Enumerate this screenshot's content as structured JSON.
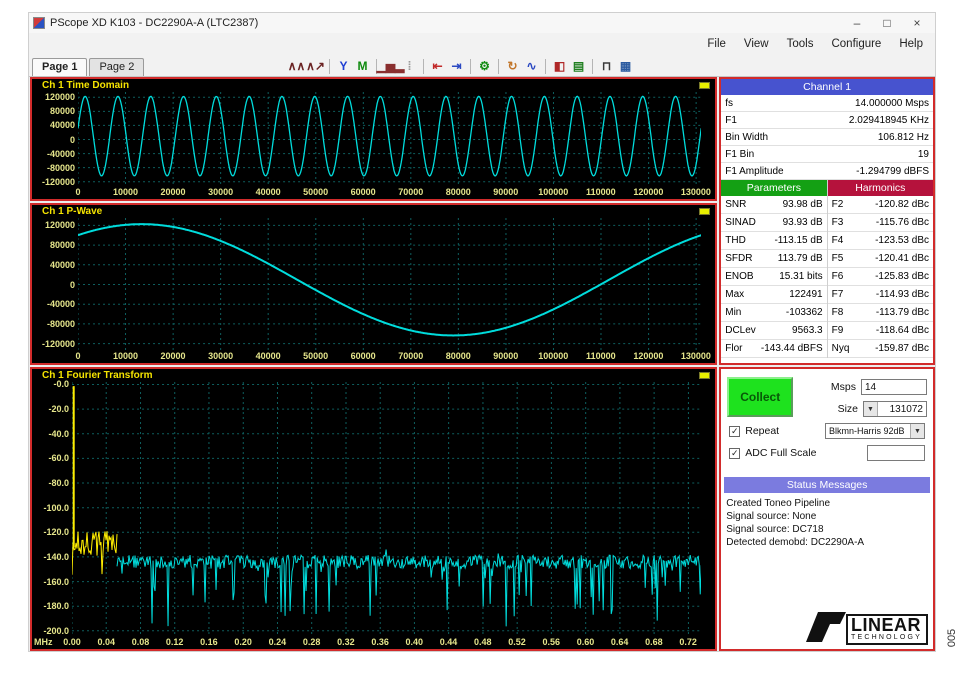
{
  "window": {
    "title": "PScope XD K103 - DC2290A-A (LTC2387)",
    "minimize_glyph": "–",
    "maximize_glyph": "□",
    "close_glyph": "×"
  },
  "figure_number": "005",
  "menu": {
    "items": [
      "File",
      "View",
      "Tools",
      "Configure",
      "Help"
    ]
  },
  "tabs": {
    "items": [
      "Page 1",
      "Page 2"
    ],
    "active": "Page 1"
  },
  "toolbar": {
    "icons": [
      {
        "name": "zoom-x-icon",
        "glyph": "∧∧",
        "color": "#6b2424"
      },
      {
        "name": "zoom-y-icon",
        "glyph": "∧↗",
        "color": "#6b2424"
      },
      {
        "sep": true
      },
      {
        "name": "y-scale-icon",
        "glyph": "Y",
        "color": "#1f3fd4"
      },
      {
        "name": "average-icon",
        "glyph": "M",
        "color": "#0e8a0e"
      },
      {
        "sep": true
      },
      {
        "name": "histogram-icon",
        "glyph": "▁▅▂",
        "color": "#8a2f2f"
      },
      {
        "name": "cursor-tool-icon",
        "glyph": "⁞",
        "color": "#9a9a9a"
      },
      {
        "sep": true
      },
      {
        "name": "import-samples-icon",
        "glyph": "⇤",
        "color": "#c22a2a"
      },
      {
        "name": "export-samples-icon",
        "glyph": "⇥",
        "color": "#2a48c2"
      },
      {
        "sep": true
      },
      {
        "name": "tools-wrench-icon",
        "glyph": "⚙",
        "color": "#0e8a0e"
      },
      {
        "sep": true
      },
      {
        "name": "resync-icon",
        "glyph": "↻",
        "color": "#c2762a"
      },
      {
        "name": "filter-icon",
        "glyph": "∿",
        "color": "#2a48c2"
      },
      {
        "sep": true
      },
      {
        "name": "device-config-icon",
        "glyph": "◧",
        "color": "#b02828"
      },
      {
        "name": "report-icon",
        "glyph": "▤",
        "color": "#1f7f1f"
      },
      {
        "sep": true
      },
      {
        "name": "pulse-view-icon",
        "glyph": "⊓",
        "color": "#3a3a3a"
      },
      {
        "name": "snapshot-icon",
        "glyph": "▦",
        "color": "#2a5aa0"
      }
    ]
  },
  "channel_panel": {
    "title": "Channel 1",
    "rows": [
      [
        "fs",
        "14.000000 Msps"
      ],
      [
        "F1",
        "2.029418945 KHz"
      ],
      [
        "Bin Width",
        "106.812 Hz"
      ],
      [
        "F1 Bin",
        "19"
      ],
      [
        "F1 Amplitude",
        "-1.294799 dBFS"
      ]
    ]
  },
  "parameters": {
    "title": "Parameters",
    "rows": [
      [
        "SNR",
        "93.98 dB"
      ],
      [
        "SINAD",
        "93.93 dB"
      ],
      [
        "THD",
        "-113.15 dB"
      ],
      [
        "SFDR",
        "113.79 dB"
      ],
      [
        "ENOB",
        "15.31 bits"
      ],
      [
        "Max",
        "122491"
      ],
      [
        "Min",
        "-103362"
      ],
      [
        "DCLev",
        "9563.3"
      ],
      [
        "Flor",
        "-143.44 dBFS"
      ]
    ]
  },
  "harmonics": {
    "title": "Harmonics",
    "rows": [
      [
        "F2",
        "-120.82 dBc"
      ],
      [
        "F3",
        "-115.76 dBc"
      ],
      [
        "F4",
        "-123.53 dBc"
      ],
      [
        "F5",
        "-120.41 dBc"
      ],
      [
        "F6",
        "-125.83 dBc"
      ],
      [
        "F7",
        "-114.93 dBc"
      ],
      [
        "F8",
        "-113.79 dBc"
      ],
      [
        "F9",
        "-118.64 dBc"
      ],
      [
        "Nyq",
        "-159.87 dBc"
      ]
    ]
  },
  "controls": {
    "collect_label": "Collect",
    "msps_label": "Msps",
    "msps_value": "14",
    "size_label": "Size",
    "size_value": "131072",
    "repeat_label": "Repeat",
    "repeat_checked": true,
    "window_value": "Blkmn-Harris 92dB",
    "adc_label": "ADC Full Scale",
    "adc_checked": true,
    "adc_value": ""
  },
  "status": {
    "title": "Status Messages",
    "lines": [
      "Created Toneo Pipeline",
      "Signal source: None",
      "Signal source: DC718",
      "Detected demobd: DC2290A-A"
    ]
  },
  "logo": {
    "brand_top": "LINEAR",
    "brand_bottom": "TECHNOLOGY"
  },
  "colors": {
    "trace": "#00dcdc",
    "fft_low_band": "#ffee00",
    "grid": "#0e5e5e",
    "plot_border": "#d22b2b",
    "channel_header": "#4753cf",
    "parameters_header": "#14a014",
    "harmonics_header": "#b5123c",
    "status_header": "#7b7bdf",
    "collect_button": "#1ee21e"
  },
  "chart_data": [
    {
      "type": "line",
      "name": "time_domain",
      "title": "Ch 1 Time Domain",
      "xlim": [
        0,
        131072
      ],
      "ylim": [
        -135000,
        135000
      ],
      "x_tick_labels": [
        "0",
        "10000",
        "20000",
        "30000",
        "40000",
        "50000",
        "60000",
        "70000",
        "80000",
        "90000",
        "100000",
        "110000",
        "120000",
        "130000"
      ],
      "x_tick_values": [
        0,
        10000,
        20000,
        30000,
        40000,
        50000,
        60000,
        70000,
        80000,
        90000,
        100000,
        110000,
        120000,
        130000
      ],
      "y_tick_labels": [
        "120000",
        "80000",
        "40000",
        "0",
        "-40000",
        "-80000",
        "-120000"
      ],
      "y_tick_values": [
        120000,
        80000,
        40000,
        0,
        -40000,
        -80000,
        -120000
      ],
      "series": [
        {
          "name": "ch1-sine",
          "waveform": "sine",
          "cycles": 19,
          "amplitude": 113000,
          "dc_offset": 9563,
          "phase_rad": 0.2,
          "color": "#00dcdc",
          "stroke": 1.3
        }
      ]
    },
    {
      "type": "line",
      "name": "p_wave",
      "title": "Ch 1 P-Wave",
      "xlim": [
        0,
        131072
      ],
      "ylim": [
        -135000,
        135000
      ],
      "x_tick_labels": [
        "0",
        "10000",
        "20000",
        "30000",
        "40000",
        "50000",
        "60000",
        "70000",
        "80000",
        "90000",
        "100000",
        "110000",
        "120000",
        "130000"
      ],
      "x_tick_values": [
        0,
        10000,
        20000,
        30000,
        40000,
        50000,
        60000,
        70000,
        80000,
        90000,
        100000,
        110000,
        120000,
        130000
      ],
      "y_tick_labels": [
        "120000",
        "80000",
        "40000",
        "0",
        "-40000",
        "-80000",
        "-120000"
      ],
      "y_tick_values": [
        120000,
        80000,
        40000,
        0,
        -40000,
        -80000,
        -120000
      ],
      "series": [
        {
          "name": "ch1-pwave",
          "waveform": "sine",
          "cycles": 1,
          "amplitude": 113000,
          "dc_offset": 9563,
          "phase_rad": 0.93,
          "color": "#00dcdc",
          "stroke": 2
        }
      ]
    },
    {
      "type": "line",
      "name": "fourier_transform",
      "title": "Ch 1 Fourier Transform",
      "x_prefix_label": "MHz",
      "xlim": [
        0,
        0.735
      ],
      "ylim": [
        -205,
        2
      ],
      "x_tick_labels": [
        "0.00",
        "0.04",
        "0.08",
        "0.12",
        "0.16",
        "0.20",
        "0.24",
        "0.28",
        "0.32",
        "0.36",
        "0.40",
        "0.44",
        "0.48",
        "0.52",
        "0.56",
        "0.60",
        "0.64",
        "0.68",
        "0.72"
      ],
      "x_tick_values": [
        0,
        0.04,
        0.08,
        0.12,
        0.16,
        0.2,
        0.24,
        0.28,
        0.32,
        0.36,
        0.4,
        0.44,
        0.48,
        0.52,
        0.56,
        0.6,
        0.64,
        0.68,
        0.72
      ],
      "y_tick_labels": [
        "-0.0",
        "-20.0",
        "-40.0",
        "-60.0",
        "-80.0",
        "-100.0",
        "-120.0",
        "-140.0",
        "-160.0",
        "-180.0",
        "-200.0"
      ],
      "y_tick_values": [
        0,
        -20,
        -40,
        -60,
        -80,
        -100,
        -120,
        -140,
        -160,
        -180,
        -200
      ],
      "fundamental": {
        "freq_mhz": 0.002,
        "amplitude_dbfs": -1.294799,
        "color": "#ffee00"
      },
      "noise_floor_dbfs": -143.44,
      "seed": 7,
      "noise_bands": [
        {
          "name": "near-carrier-band",
          "color": "#ffee00",
          "range_mhz": [
            0,
            0.052
          ],
          "mean_db": -129,
          "jitter_db": 20,
          "spike_chance": 0.1,
          "spike_depth_db": 16
        },
        {
          "name": "noise-floor",
          "color": "#00dcdc",
          "range_mhz": [
            0.052,
            0.735
          ],
          "mean_db": -144,
          "jitter_db": 11,
          "spike_chance": 0.09,
          "spike_depth_db": 50
        }
      ]
    }
  ]
}
